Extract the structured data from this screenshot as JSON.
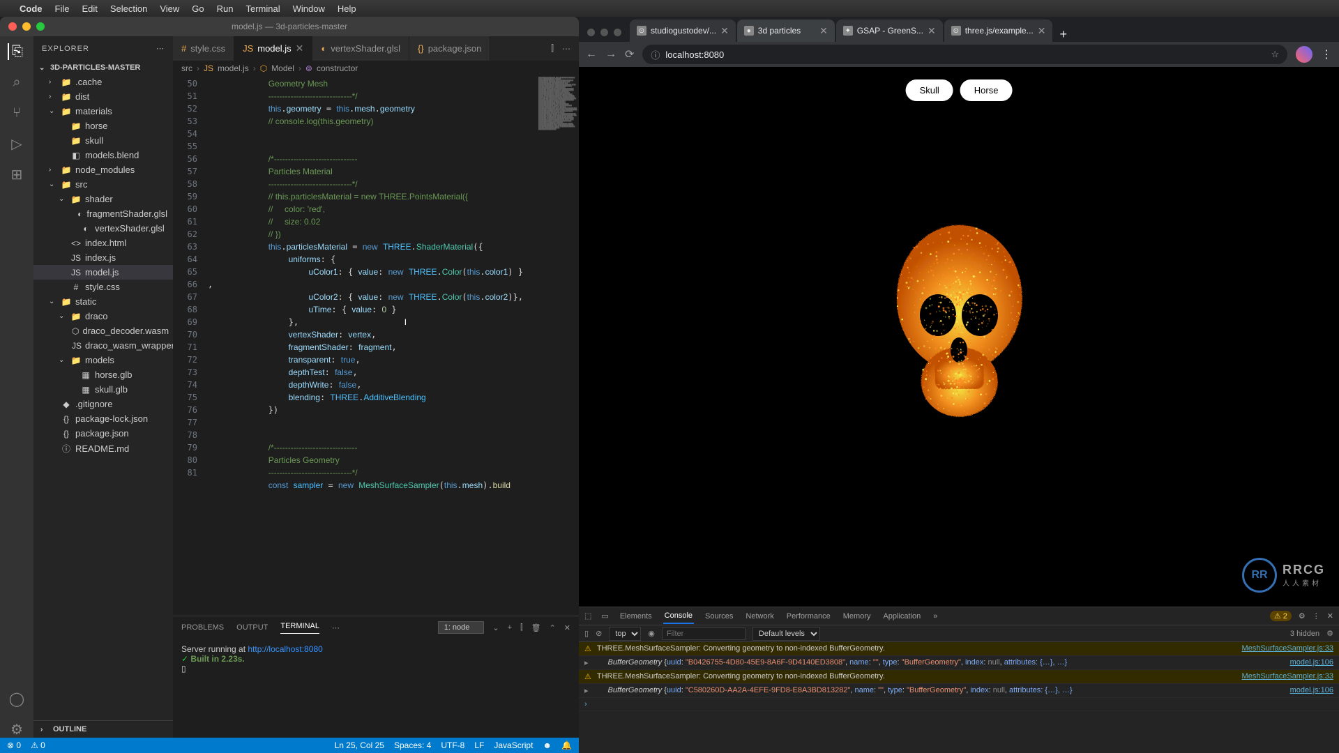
{
  "macos_menu": [
    "Code",
    "File",
    "Edit",
    "Selection",
    "View",
    "Go",
    "Run",
    "Terminal",
    "Window",
    "Help"
  ],
  "vscode": {
    "title": "model.js — 3d-particles-master",
    "explorer_label": "EXPLORER",
    "project_name": "3D-PARTICLES-MASTER",
    "outline_label": "OUTLINE",
    "tree": [
      {
        "label": ".cache",
        "indent": 1,
        "chev": "›",
        "icon": "📁"
      },
      {
        "label": "dist",
        "indent": 1,
        "chev": "›",
        "icon": "📁"
      },
      {
        "label": "materials",
        "indent": 1,
        "chev": "⌄",
        "icon": "📁"
      },
      {
        "label": "horse",
        "indent": 2,
        "icon": "📁"
      },
      {
        "label": "skull",
        "indent": 2,
        "icon": "📁"
      },
      {
        "label": "models.blend",
        "indent": 2,
        "icon": "◧"
      },
      {
        "label": "node_modules",
        "indent": 1,
        "chev": "›",
        "icon": "📁"
      },
      {
        "label": "src",
        "indent": 1,
        "chev": "⌄",
        "icon": "📁"
      },
      {
        "label": "shader",
        "indent": 2,
        "chev": "⌄",
        "icon": "📁"
      },
      {
        "label": "fragmentShader.glsl",
        "indent": 3,
        "icon": "◐"
      },
      {
        "label": "vertexShader.glsl",
        "indent": 3,
        "icon": "◐"
      },
      {
        "label": "index.html",
        "indent": 2,
        "icon": "<>"
      },
      {
        "label": "index.js",
        "indent": 2,
        "icon": "JS"
      },
      {
        "label": "model.js",
        "indent": 2,
        "icon": "JS",
        "selected": true
      },
      {
        "label": "style.css",
        "indent": 2,
        "icon": "#"
      },
      {
        "label": "static",
        "indent": 1,
        "chev": "⌄",
        "icon": "📁"
      },
      {
        "label": "draco",
        "indent": 2,
        "chev": "⌄",
        "icon": "📁"
      },
      {
        "label": "draco_decoder.wasm",
        "indent": 3,
        "icon": "⬡"
      },
      {
        "label": "draco_wasm_wrapper.js",
        "indent": 3,
        "icon": "JS"
      },
      {
        "label": "models",
        "indent": 2,
        "chev": "⌄",
        "icon": "📁"
      },
      {
        "label": "horse.glb",
        "indent": 3,
        "icon": "▦"
      },
      {
        "label": "skull.glb",
        "indent": 3,
        "icon": "▦"
      },
      {
        "label": ".gitignore",
        "indent": 1,
        "icon": "◆"
      },
      {
        "label": "package-lock.json",
        "indent": 1,
        "icon": "{}"
      },
      {
        "label": "package.json",
        "indent": 1,
        "icon": "{}"
      },
      {
        "label": "README.md",
        "indent": 1,
        "icon": "ⓘ"
      }
    ],
    "tabs": [
      {
        "label": "style.css",
        "icon": "#"
      },
      {
        "label": "model.js",
        "icon": "JS",
        "active": true,
        "close": true
      },
      {
        "label": "vertexShader.glsl",
        "icon": "◐"
      },
      {
        "label": "package.json",
        "icon": "{}"
      }
    ],
    "breadcrumb": [
      "src",
      "model.js",
      "Model",
      "constructor"
    ],
    "line_start": 50,
    "line_end": 81,
    "terminal_tabs": [
      "PROBLEMS",
      "OUTPUT",
      "TERMINAL"
    ],
    "terminal_active": "TERMINAL",
    "terminal_dropdown": "1: node",
    "terminal_line1_prefix": "Server running at ",
    "terminal_url": "http://localhost:8080",
    "terminal_line2": "Built in 2.23s.",
    "status": {
      "errors": "0",
      "warnings": "0",
      "cursor": "Ln 25, Col 25",
      "spaces": "Spaces: 4",
      "encoding": "UTF-8",
      "eol": "LF",
      "lang": "JavaScript"
    }
  },
  "browser": {
    "tabs": [
      {
        "label": "studiogustodev/...",
        "favicon": "⊙"
      },
      {
        "label": "3d particles",
        "favicon": "●",
        "active": true
      },
      {
        "label": "GSAP - GreenS...",
        "favicon": "✦"
      },
      {
        "label": "three.js/example...",
        "favicon": "⊙"
      }
    ],
    "url": "localhost:8080",
    "page_buttons": [
      "Skull",
      "Horse"
    ],
    "watermark_text": "RRCG",
    "watermark_sub": "人人素材",
    "devtools": {
      "tabs": [
        "Elements",
        "Console",
        "Sources",
        "Network",
        "Performance",
        "Memory",
        "Application"
      ],
      "active": "Console",
      "warn_count": "2",
      "filter_placeholder": "Filter",
      "context": "top",
      "levels": "Default levels",
      "hidden": "3 hidden",
      "rows": [
        {
          "type": "warn",
          "msg": "THREE.MeshSurfaceSampler: Converting geometry to non-indexed BufferGeometry.",
          "src": "MeshSurfaceSampler.js:33"
        },
        {
          "type": "log",
          "src": "model.js:106",
          "obj_prefix": "BufferGeometry ",
          "uuid": "B0426755-4D80-45E9-8A6F-9D4140ED3808",
          "name": "",
          "type_str": "BufferGeometry",
          "index": "null",
          "rest": "attributes: {…}, …}"
        },
        {
          "type": "warn",
          "msg": "THREE.MeshSurfaceSampler: Converting geometry to non-indexed BufferGeometry.",
          "src": "MeshSurfaceSampler.js:33"
        },
        {
          "type": "log",
          "src": "model.js:106",
          "obj_prefix": "BufferGeometry ",
          "uuid": "C580260D-AA2A-4EFE-9FD8-E8A3BD813282",
          "name": "",
          "type_str": "BufferGeometry",
          "index": "null",
          "rest": "attributes: {…}, …}"
        }
      ]
    }
  }
}
